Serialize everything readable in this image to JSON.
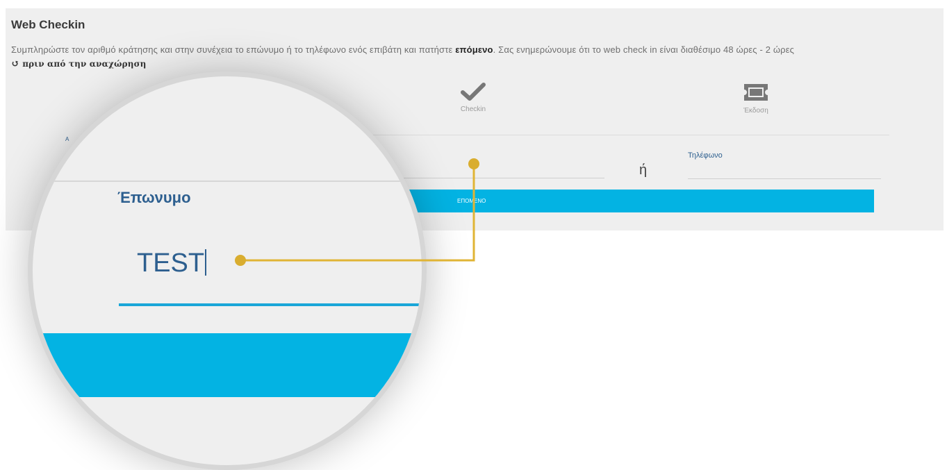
{
  "page": {
    "title": "Web Checkin",
    "intro_before": "Συμπληρώστε τον αριθμό κράτησης και στην συνέχεια το επώνυμο ή το τηλέφωνο ενός επιβάτη και πατήστε ",
    "intro_bold": "επόμενο",
    "intro_after": ". Σας ενημερώνουμε ότι το web check in είναι διαθέσιμο 48 ώρες - 2 ώρες",
    "intro_icon": "↺",
    "intro_second_line": "πριν από την αναχώρηση"
  },
  "steps": [
    {
      "label": "Checkin",
      "icon": "checkmark-icon"
    },
    {
      "label": "Έκδοση",
      "icon": "ticket-icon"
    }
  ],
  "form": {
    "booking_label_fragment": "Α",
    "or_text": "ή",
    "phone_label": "Τηλέφωνο",
    "next_label": "ΕΠΟΜΕΝΟ"
  },
  "magnifier": {
    "surname_label": "Έπωνυμο",
    "surname_value": "TEST"
  },
  "colors": {
    "accent": "#03b3e3",
    "label": "#2d5f8f",
    "callout": "#e0b435"
  }
}
